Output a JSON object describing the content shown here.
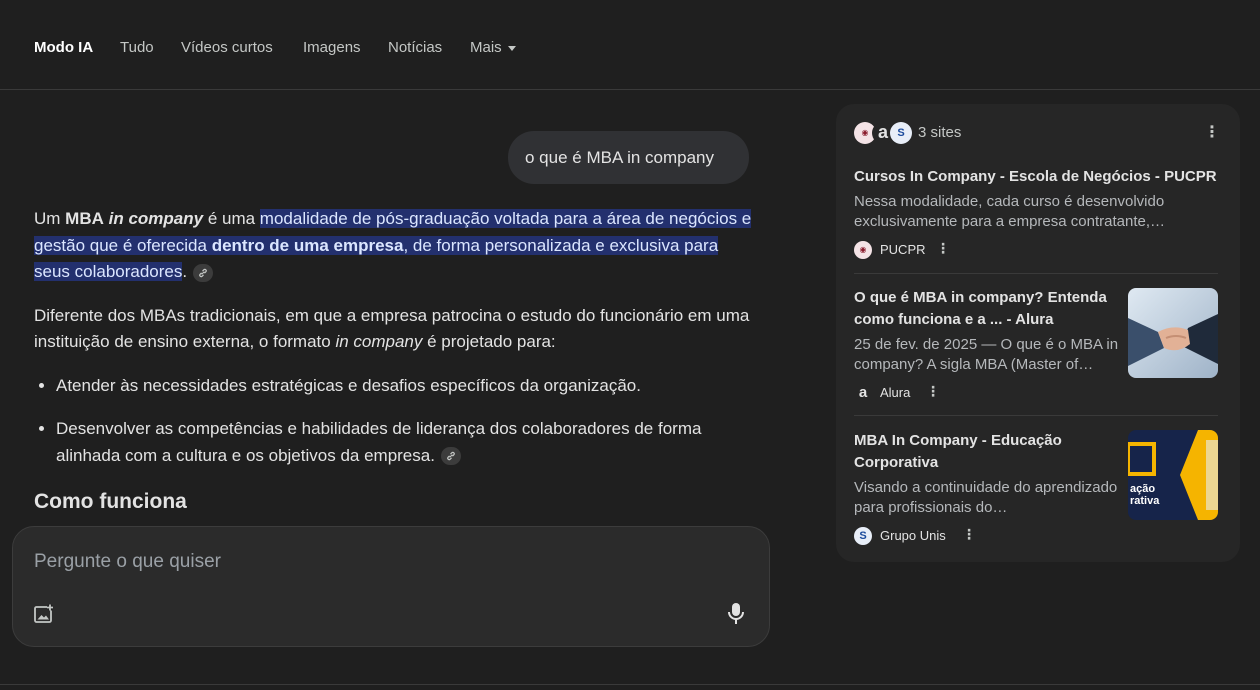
{
  "nav": {
    "tabs": [
      {
        "label": "Modo IA",
        "active": true
      },
      {
        "label": "Tudo"
      },
      {
        "label": "Vídeos curtos"
      },
      {
        "label": "Imagens"
      },
      {
        "label": "Notícias"
      },
      {
        "label": "Mais"
      }
    ]
  },
  "conversation": {
    "user_query": "o que é MBA in company",
    "answer": {
      "p1": {
        "part1": "Um ",
        "bold1": "MBA",
        "part2": " ",
        "bolditalic1": "in company",
        "part3": " é uma ",
        "hl1": "modalidade de pós-graduação voltada para a área de negócios e gestão que é oferecida ",
        "hl_bold": "dentro de uma empresa",
        "hl2": ", de forma personalizada e exclusiva para seus colaboradores",
        "end": "."
      },
      "p2": {
        "part1": "Diferente dos MBAs tradicionais, em que a empresa patrocina o estudo do funcionário em uma instituição de ensino externa, o formato ",
        "italic": "in company",
        "part2": " é projetado para:"
      },
      "bullets": [
        "Atender às necessidades estratégicas e desafios específicos da organização.",
        "Desenvolver as competências e habilidades de liderança dos colaboradores de forma alinhada com a cultura e os objetivos da empresa."
      ],
      "heading": "Como funciona"
    }
  },
  "composer": {
    "placeholder": "Pergunte o que quiser",
    "icons": [
      "add-image-icon",
      "microphone-icon"
    ]
  },
  "sources_panel": {
    "count_label": "3 sites",
    "cards": [
      {
        "title": "Cursos In Company - Escola de Negócios - PUCPR",
        "snippet": "Nessa modalidade, cada curso é desenvolvido exclusivamente para a empresa contratante,…",
        "source": "PUCPR"
      },
      {
        "title": "O que é MBA in company? Entenda como funciona e a ... - Alura",
        "snippet": "25 de fev. de 2025 — O que é o MBA in company? A sigla MBA (Master of…",
        "source": "Alura",
        "thumbnail": "handshake-image"
      },
      {
        "title": "MBA In Company - Educação Corporativa",
        "snippet": "Visando a continuidade do aprendizado para profissionais do…",
        "source": "Grupo Unis",
        "thumbnail": "educacao-corporativa-banner",
        "thumb_text": "ação\nrativa"
      }
    ]
  },
  "colors": {
    "background": "#1f1f1f",
    "highlight": "#23306e",
    "bubble": "#303134",
    "panel": "#262626"
  }
}
